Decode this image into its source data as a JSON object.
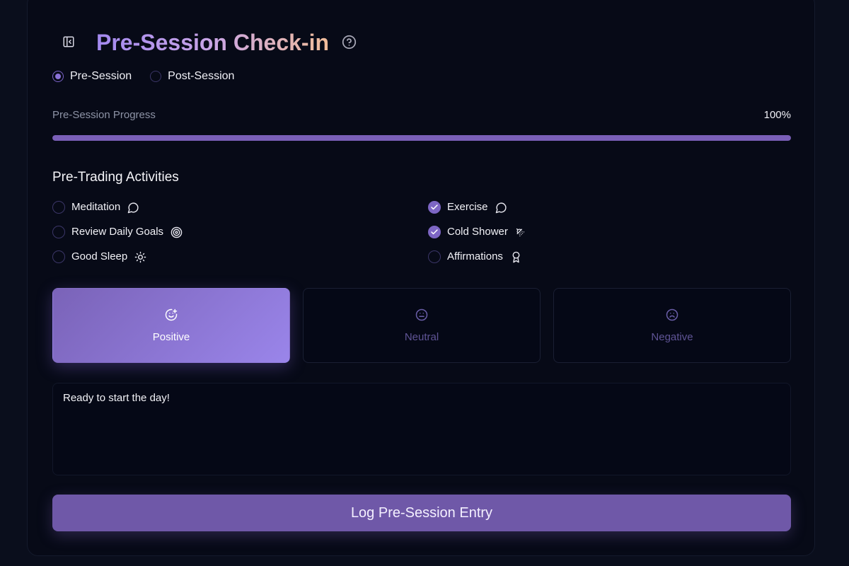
{
  "header": {
    "title": "Pre-Session Check-in",
    "title_gradient": [
      "#a389f0",
      "#c9a5e6",
      "#f1bd9a"
    ]
  },
  "mode": {
    "options": [
      {
        "label": "Pre-Session",
        "selected": true
      },
      {
        "label": "Post-Session",
        "selected": false
      }
    ]
  },
  "progress": {
    "label": "Pre-Session Progress",
    "value_text": "100%",
    "fraction": 1.0,
    "color": "#7a5fb8"
  },
  "activities": {
    "title": "Pre-Trading Activities",
    "items": [
      {
        "label": "Meditation",
        "checked": false,
        "icon": "message-circle-icon"
      },
      {
        "label": "Review Daily Goals",
        "checked": false,
        "icon": "target-icon"
      },
      {
        "label": "Good Sleep",
        "checked": false,
        "icon": "sun-icon"
      },
      {
        "label": "Exercise",
        "checked": true,
        "icon": "message-circle-icon"
      },
      {
        "label": "Cold Shower",
        "checked": true,
        "icon": "shower-head-icon"
      },
      {
        "label": "Affirmations",
        "checked": false,
        "icon": "award-icon"
      }
    ]
  },
  "mood": {
    "options": [
      {
        "label": "Positive",
        "icon": "smile-plus-icon",
        "selected": true
      },
      {
        "label": "Neutral",
        "icon": "meh-icon",
        "selected": false
      },
      {
        "label": "Negative",
        "icon": "frown-icon",
        "selected": false
      }
    ],
    "active_gradient": [
      "#7a63b8",
      "#9a85ea"
    ]
  },
  "notes": {
    "value": "Ready to start the day!"
  },
  "submit": {
    "label": "Log Pre-Session Entry",
    "color": "#6f58a8"
  }
}
